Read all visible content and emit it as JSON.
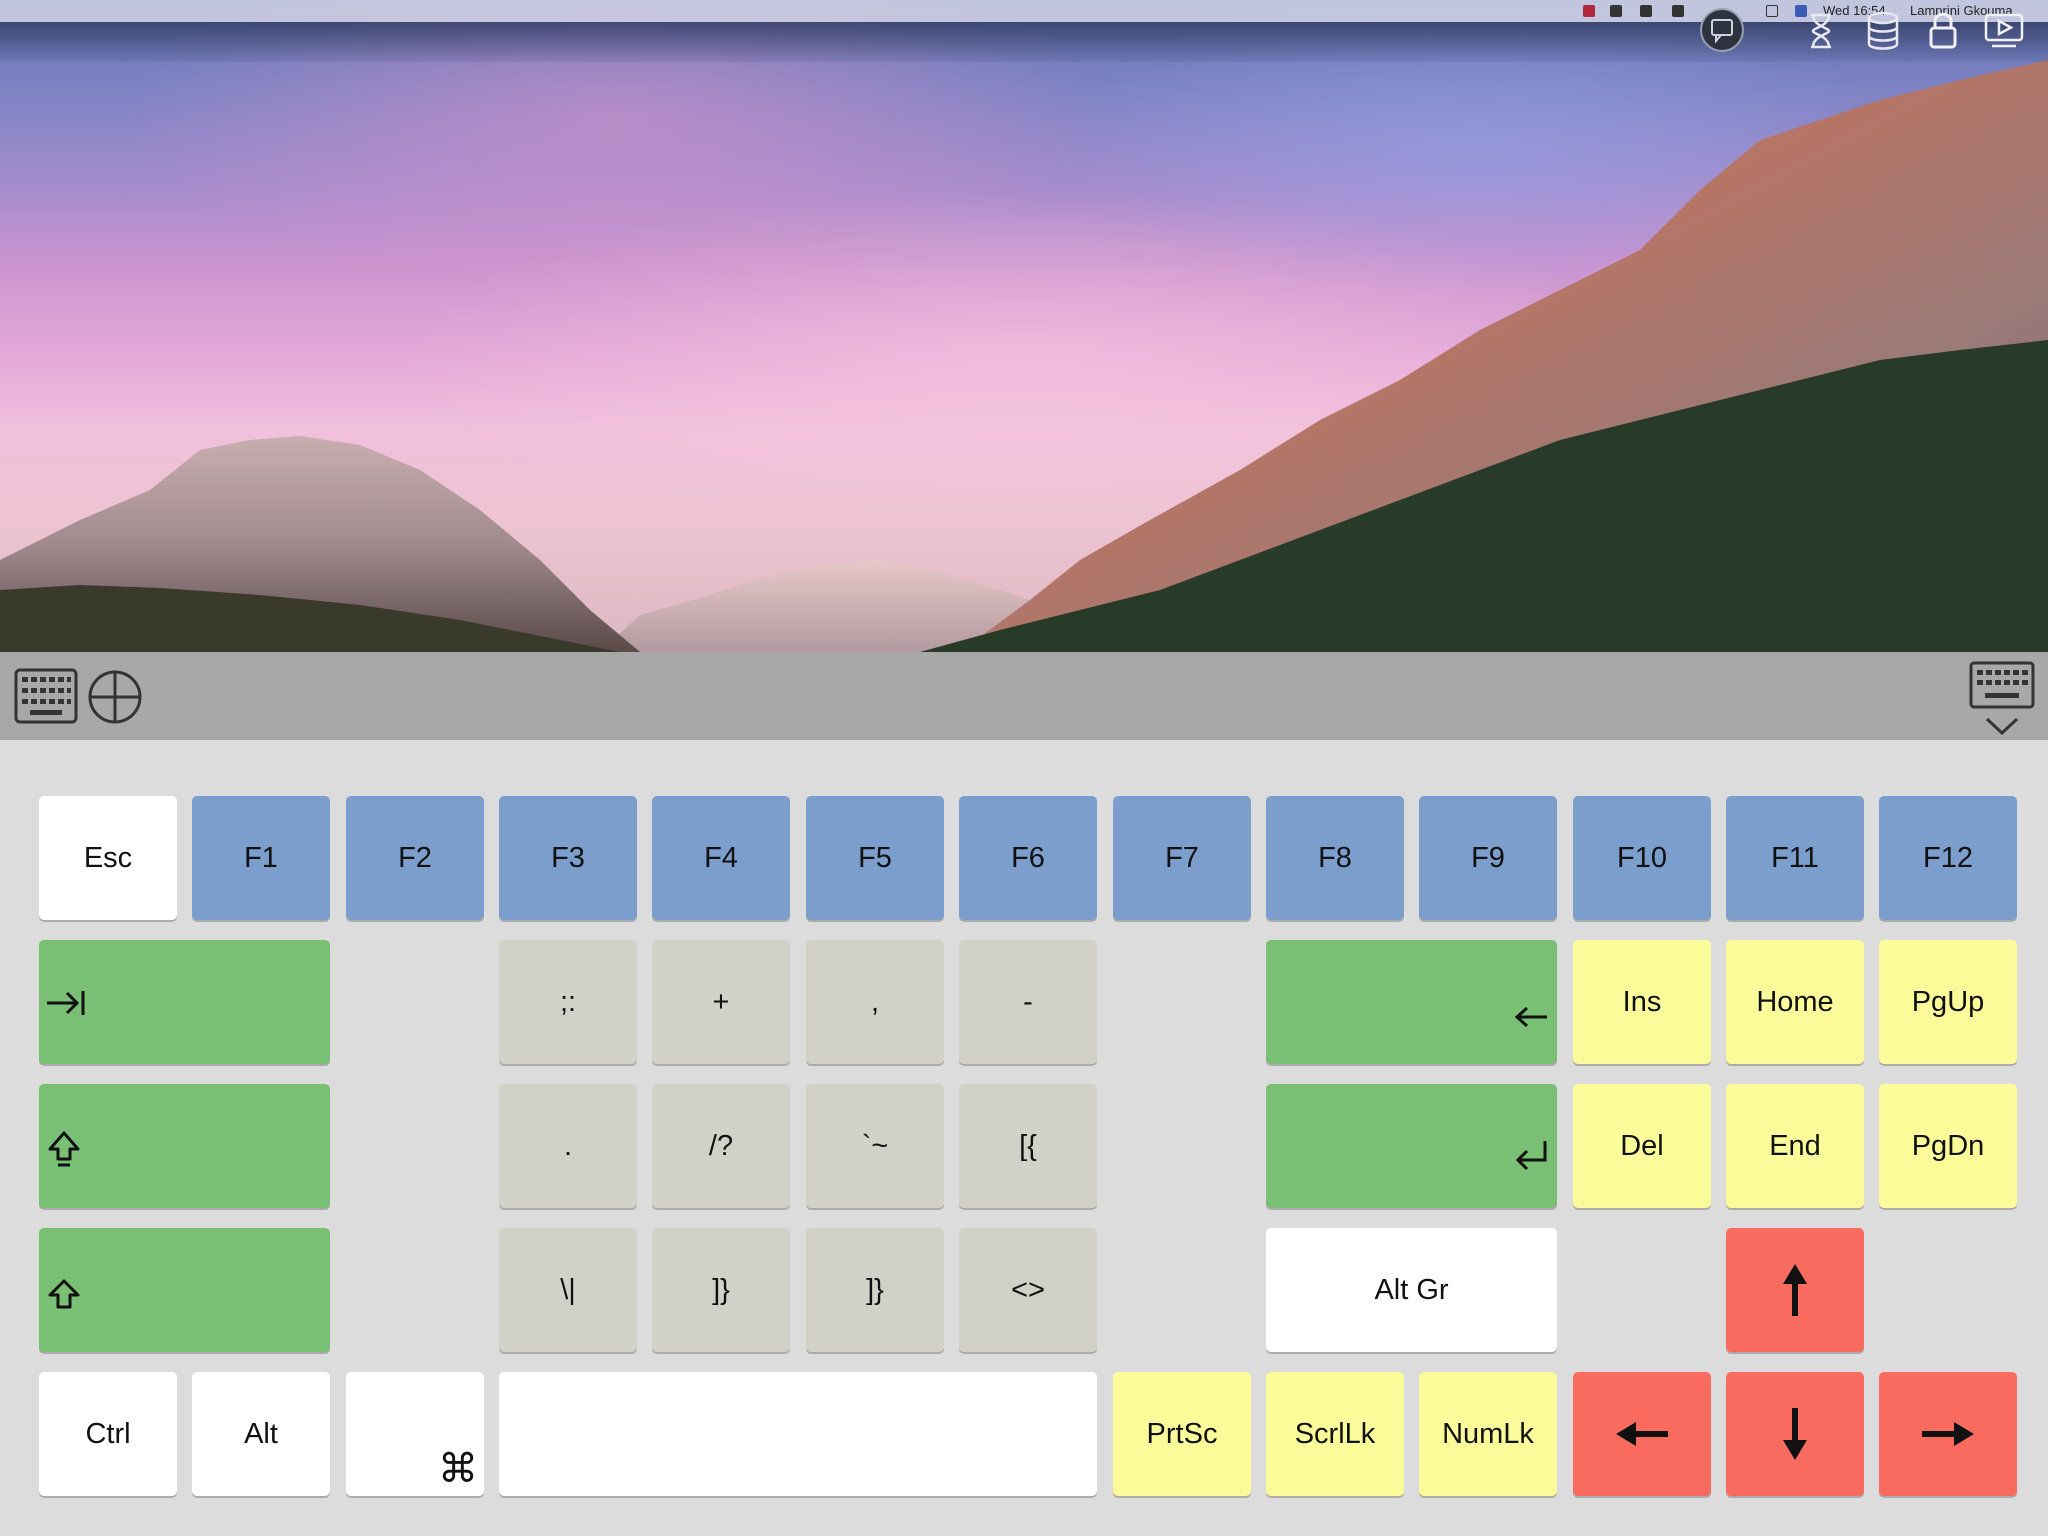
{
  "menubar": {
    "date_time": "Wed 16:54",
    "user_name": "Lamprini Gkouma"
  },
  "colors": {
    "function_key": "#7b9ecd",
    "modifier_key": "#79c075",
    "symbol_key": "#d1d1c8",
    "navigation_key": "#fbfb9a",
    "arrow_key": "#fa6b5f",
    "plain_key": "#ffffff",
    "toolbar": "#a8a8a8",
    "keyboard_bg": "#dcdcdc"
  },
  "toolbar": {
    "left_icons": [
      "keyboard-icon",
      "crosshair-icon"
    ],
    "right_icon": "keyboard-hide-icon"
  },
  "keyboard": {
    "row1": [
      "Esc",
      "F1",
      "F2",
      "F3",
      "F4",
      "F5",
      "F6",
      "F7",
      "F8",
      "F9",
      "F10",
      "F11",
      "F12"
    ],
    "symbols_row2": [
      ";:",
      "+",
      ",",
      "-"
    ],
    "symbols_row3": [
      ".",
      "/?",
      "`~",
      "[{"
    ],
    "symbols_row4": [
      "\\|",
      "]}",
      "]}",
      "<>"
    ],
    "nav_row2": [
      "Ins",
      "Home",
      "PgUp"
    ],
    "nav_row3": [
      "Del",
      "End",
      "PgDn"
    ],
    "alt_gr": "Alt Gr",
    "bottom": {
      "ctrl": "Ctrl",
      "alt": "Alt",
      "command_glyph": "⌘",
      "prtsc": "PrtSc",
      "scrlk": "ScrlLk",
      "numlk": "NumLk"
    },
    "glyphs": {
      "tab": "⇥",
      "caps": "⇪",
      "shift": "⇧",
      "backspace": "←",
      "enter": "↵"
    }
  }
}
